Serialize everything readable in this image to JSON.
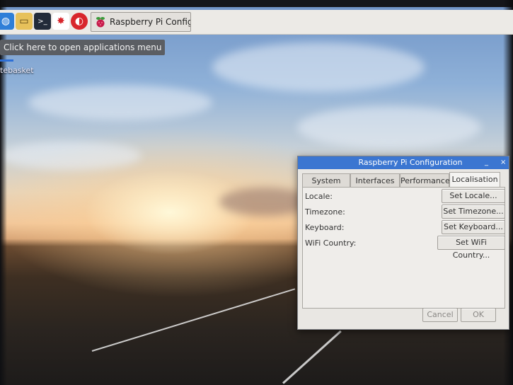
{
  "taskbar": {
    "icons": [
      {
        "name": "web-browser-icon",
        "glyph": "◍",
        "bg": "#2f7fd8",
        "fg": "#ffffff"
      },
      {
        "name": "file-manager-icon",
        "glyph": "▭",
        "bg": "#e7c15a",
        "fg": "#5a4410"
      },
      {
        "name": "terminal-icon",
        "glyph": ">_",
        "bg": "#222b3a",
        "fg": "#ffffff"
      },
      {
        "name": "math-kernel-icon",
        "glyph": "✸",
        "bg": "#ffffff",
        "fg": "#d8262c"
      },
      {
        "name": "wolfram-icon",
        "glyph": "◐",
        "bg": "#d8262c",
        "fg": "#ffffff"
      }
    ],
    "task_button": {
      "label": "Raspberry Pi Configu...",
      "icon": "raspberry-icon"
    }
  },
  "tooltip": {
    "text": "Click here to open applications menu"
  },
  "desktop": {
    "label": "tebasket"
  },
  "dialog": {
    "title": "Raspberry Pi Configuration",
    "controls": {
      "minimize": "_",
      "close": "×"
    },
    "tabs": [
      {
        "label": "System"
      },
      {
        "label": "Interfaces"
      },
      {
        "label": "Performance"
      },
      {
        "label": "Localisation"
      }
    ],
    "rows": [
      {
        "label": "Locale:",
        "button": "Set Locale..."
      },
      {
        "label": "Timezone:",
        "button": "Set Timezone..."
      },
      {
        "label": "Keyboard:",
        "button": "Set Keyboard..."
      },
      {
        "label": "WiFi Country:",
        "button": "Set WiFi Country..."
      }
    ],
    "footer": {
      "cancel": "Cancel",
      "ok": "OK"
    }
  },
  "colors": {
    "titlebar": "#3b76d1",
    "accent": "#2e6fd6"
  }
}
